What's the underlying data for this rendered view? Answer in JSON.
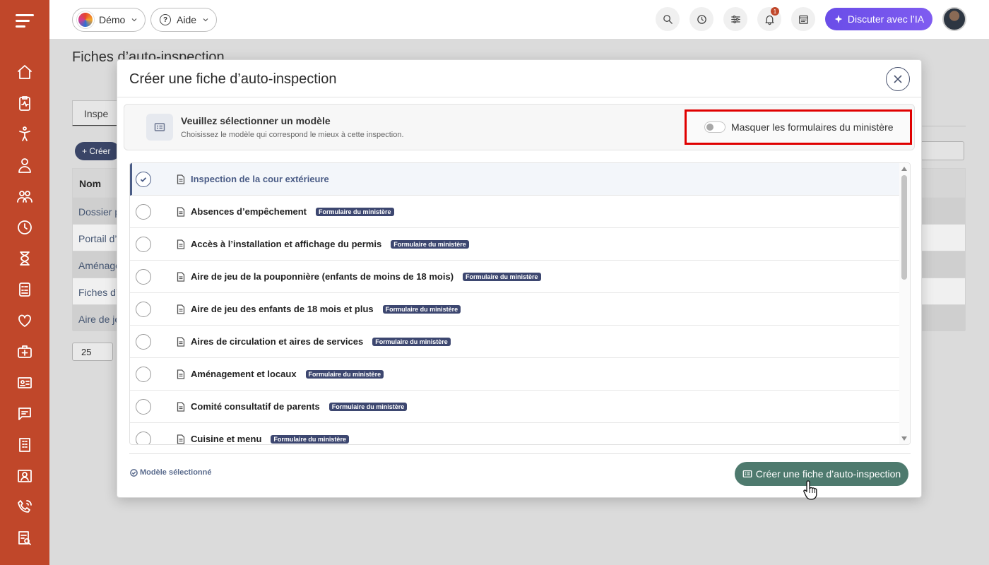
{
  "topbar": {
    "org_label": "Démo",
    "help_label": "Aide",
    "notification_count": "1",
    "ai_button_label": "Discuter avec l’IA"
  },
  "background": {
    "page_title": "Fiches d’auto-inspection",
    "tab_label": "Inspe",
    "create_label": "+ Créer",
    "table_header": "Nom",
    "rows": [
      "Dossier p",
      "Portail d’",
      "Aménage",
      "Fiches d’",
      "Aire de je"
    ],
    "page_size": "25"
  },
  "modal": {
    "title": "Créer une fiche d’auto-inspection",
    "panel_title": "Veuillez sélectionner un modèle",
    "panel_subtitle": "Choisissez le modèle qui correspond le mieux à cette inspection.",
    "toggle_label": "Masquer les formulaires du ministère",
    "toggle_on": false,
    "items": [
      {
        "label": "Inspection de la cour extérieure",
        "badge": "",
        "selected": true
      },
      {
        "label": "Absences d’empêchement",
        "badge": "Formulaire du ministère",
        "selected": false
      },
      {
        "label": "Accès à l’installation et affichage du permis",
        "badge": "Formulaire du ministère",
        "selected": false
      },
      {
        "label": "Aire de jeu de la pouponnière (enfants de moins de 18 mois)",
        "badge": "Formulaire du ministère",
        "selected": false
      },
      {
        "label": "Aire de jeu des enfants de 18 mois et plus",
        "badge": "Formulaire du ministère",
        "selected": false
      },
      {
        "label": "Aires de circulation et aires de services",
        "badge": "Formulaire du ministère",
        "selected": false
      },
      {
        "label": "Aménagement et locaux",
        "badge": "Formulaire du ministère",
        "selected": false
      },
      {
        "label": "Comité consultatif de parents",
        "badge": "Formulaire du ministère",
        "selected": false
      },
      {
        "label": "Cuisine et menu",
        "badge": "Formulaire du ministère",
        "selected": false
      }
    ],
    "selected_note": "Modèle sélectionné",
    "create_button_label": "Créer une fiche d’auto-inspection"
  },
  "colors": {
    "sidebar": "#c0472a",
    "primary_navy": "#3d4770",
    "create_button": "#4e7a6e",
    "ai_purple": "#6a4de8",
    "highlight_red": "#e00000"
  }
}
